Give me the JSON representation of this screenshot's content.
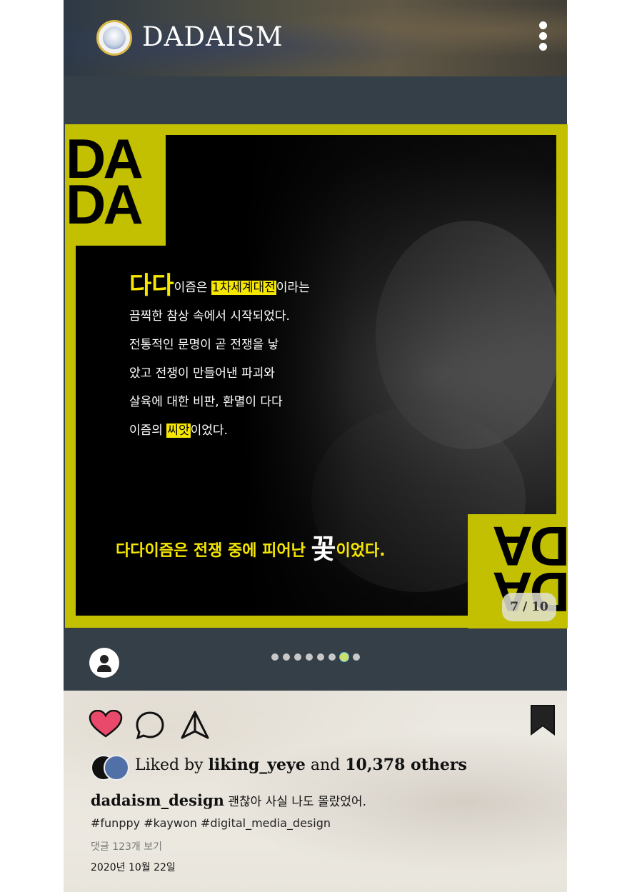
{
  "header": {
    "brand": "DADAISM"
  },
  "slide": {
    "corner_text": [
      "DA",
      "DA"
    ],
    "body": {
      "lead_big": "다다",
      "lead_rest_1": "이즘은 ",
      "highlight_1": "1차세계대전",
      "lead_rest_2": "이라는",
      "line_2": "끔찍한 참상 속에서 시작되었다.",
      "line_3": "전통적인 문명이 곧 전쟁을 낳",
      "line_4": "았고 전쟁이 만들어낸 파괴와",
      "line_5": "살육에 대한 비판, 환멸이 다다",
      "line_6_pre": "이즘의 ",
      "highlight_2": "씨앗",
      "line_6_post": "이었다."
    },
    "tagline_pre": "다다이즘은 전쟁 중에 피어난 ",
    "tagline_flower": "꽃",
    "tagline_post": "이었다.",
    "counter": "7 / 10"
  },
  "carousel": {
    "count": 8,
    "active_index": 6
  },
  "post": {
    "liked_prefix": "Liked by ",
    "liked_user": "liking_yeye",
    "liked_mid": " and ",
    "liked_count": "10,378 others",
    "username": "dadaism_design",
    "caption": "괜찮아 사실 나도 몰랐었어.",
    "hashtags": "#funppy #kaywon #digital_media_design",
    "comments_link": "댓글 123개 보기",
    "date": "2020년 10월 22일"
  },
  "colors": {
    "accent_yellow": "#f6e600",
    "frame_olive": "#c2c000",
    "post_bg": "#353f48",
    "heart": "#e94a6b"
  },
  "icons": {
    "profile": "user-icon",
    "menu": "kebab-menu-icon",
    "like": "heart-icon",
    "comment": "comment-icon",
    "share": "send-icon",
    "save": "bookmark-icon"
  }
}
